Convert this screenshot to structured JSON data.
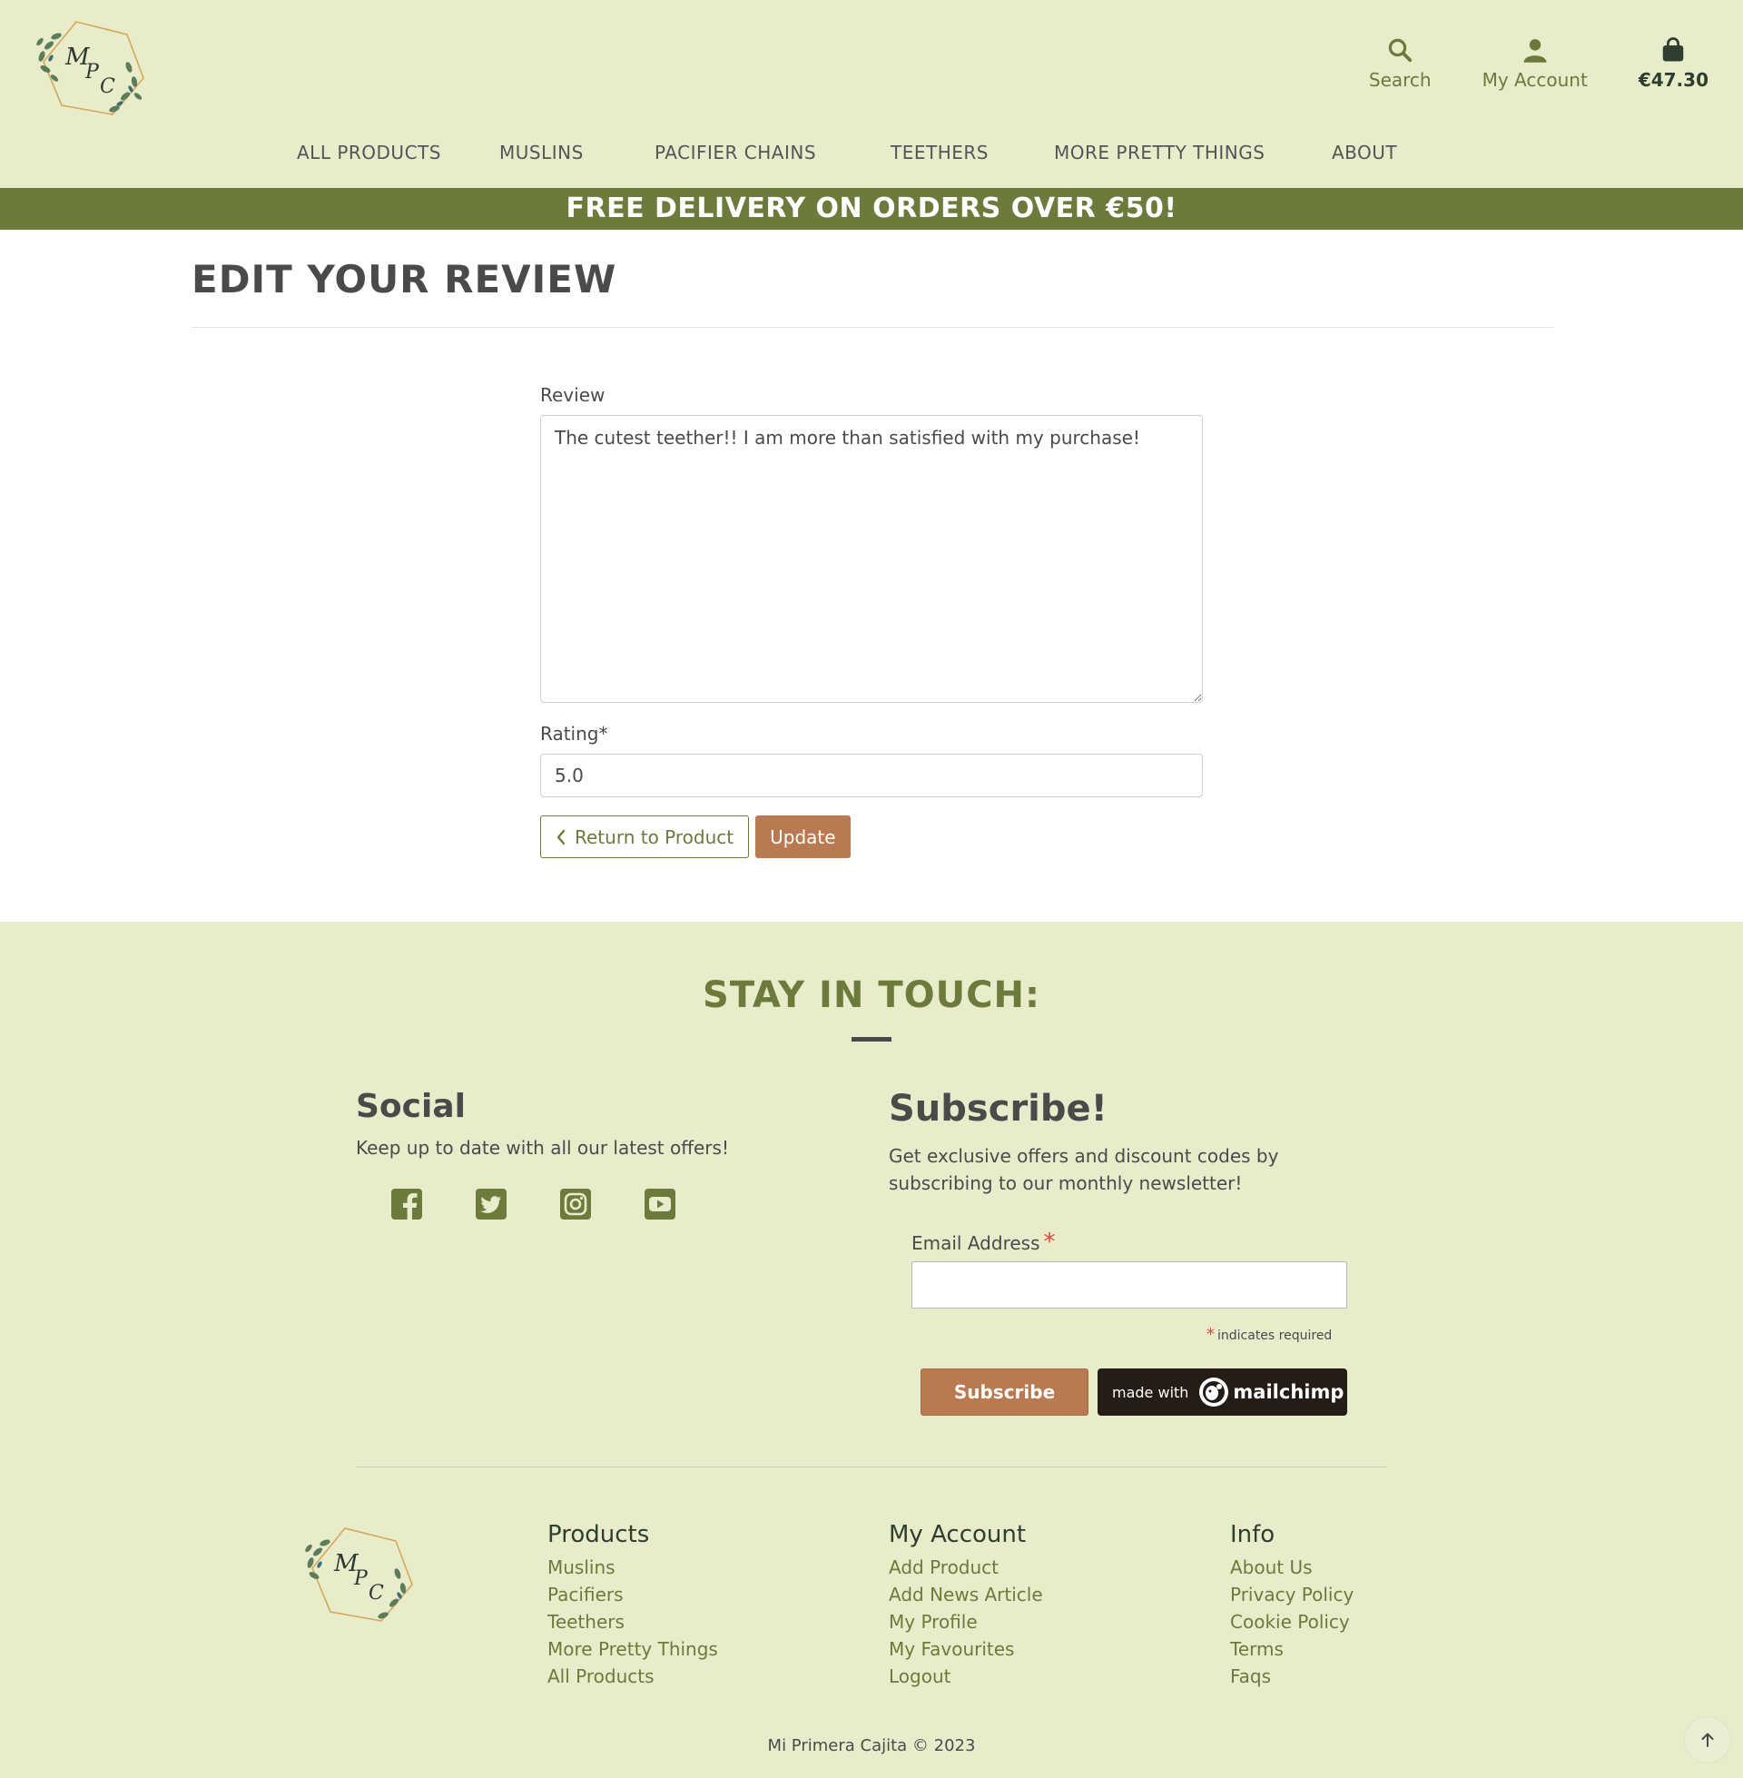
{
  "header": {
    "logo_text": "MPC",
    "actions": {
      "search_label": "Search",
      "account_label": "My Account",
      "cart_label": "€47.30"
    },
    "nav": [
      "ALL PRODUCTS",
      "MUSLINS",
      "PACIFIER CHAINS",
      "TEETHERS",
      "MORE PRETTY THINGS",
      "ABOUT"
    ],
    "banner": "FREE DELIVERY ON ORDERS OVER €50!"
  },
  "main": {
    "title": "EDIT YOUR REVIEW",
    "review_label": "Review",
    "review_value": "The cutest teether!! I am more than satisfied with my purchase!",
    "rating_label": "Rating*",
    "rating_value": "5.0",
    "return_label": "Return to Product",
    "update_label": "Update"
  },
  "footer": {
    "stay_title": "STAY IN TOUCH:",
    "social": {
      "title": "Social",
      "text": "Keep up to date with all our latest offers!",
      "icons": [
        "facebook-icon",
        "twitter-icon",
        "instagram-icon",
        "youtube-icon"
      ]
    },
    "subscribe": {
      "title": "Subscribe!",
      "text": "Get exclusive offers and discount codes by subscribing to our monthly newsletter!",
      "email_label": "Email Address",
      "required_note": "indicates required",
      "button_label": "Subscribe",
      "badge_made_with": "made with",
      "badge_brand": "mailchimp"
    },
    "columns": {
      "products": {
        "title": "Products",
        "links": [
          "Muslins",
          "Pacifiers",
          "Teethers",
          "More Pretty Things",
          "All Products"
        ]
      },
      "account": {
        "title": "My Account",
        "links": [
          "Add Product",
          "Add News Article",
          "My Profile",
          "My Favourites",
          "Logout"
        ]
      },
      "info": {
        "title": "Info",
        "links": [
          "About Us",
          "Privacy Policy",
          "Cookie Policy",
          "Terms",
          "Faqs"
        ]
      }
    },
    "copyright": "Mi Primera Cajita © 2023"
  },
  "colors": {
    "header_bg": "#e9eccb",
    "banner_bg": "#6c7a3c",
    "accent_button": "#b97951",
    "text_dark": "#4a4a4a"
  }
}
